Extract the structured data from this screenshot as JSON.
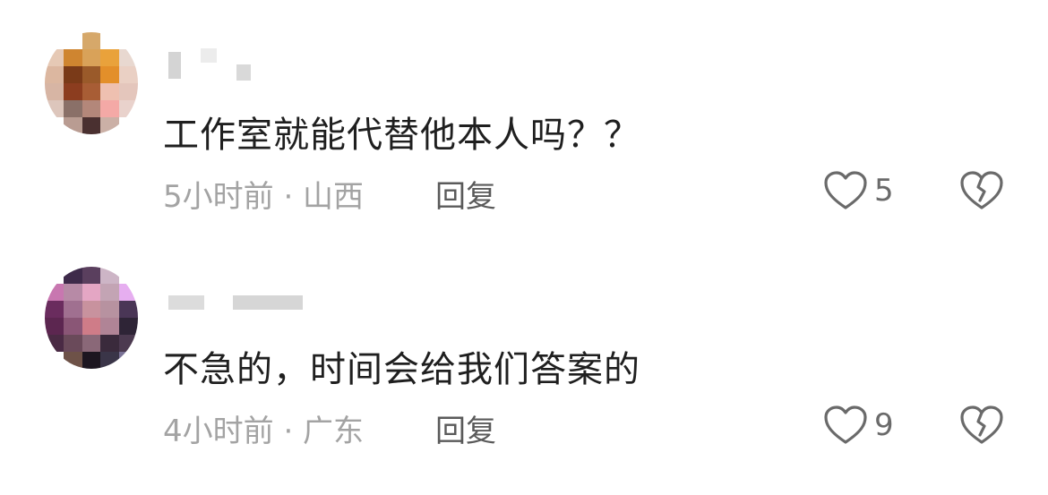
{
  "comments": [
    {
      "text": "工作室就能代替他本人吗？？",
      "meta": "5小时前 · 山西",
      "reply_label": "回复",
      "like_count": "5",
      "icons": {
        "like": "heart-outline-icon",
        "dislike": "broken-heart-icon"
      },
      "avatar_palette": [
        "#ffffff",
        "#ffffff",
        "#d6a86a",
        "#ffffff",
        "#ffffff",
        "#e6c9b5",
        "#cf8530",
        "#d9a259",
        "#e9a23b",
        "#e8d8d0",
        "#dcb7a0",
        "#7a3a18",
        "#9a5a2a",
        "#e38f2a",
        "#ead0c4",
        "#d7b5a4",
        "#8c3d1f",
        "#a85d35",
        "#eec0b0",
        "#e4c6bc",
        "#ddc6bc",
        "#8a7068",
        "#b3877a",
        "#f4a9a6",
        "#e9d2cc",
        "#ffffff",
        "#b99c92",
        "#4a3030",
        "#cbb0a6",
        "#ffffff"
      ]
    },
    {
      "text": "不急的，时间会给我们答案的",
      "meta": "4小时前 · 广东",
      "reply_label": "回复",
      "like_count": "9",
      "icons": {
        "like": "heart-outline-icon",
        "dislike": "broken-heart-icon"
      },
      "avatar_palette": [
        "#ffffff",
        "#3e2a4a",
        "#5a3f5e",
        "#cdb5c6",
        "#ffffff",
        "#c877b0",
        "#b78aa6",
        "#e4a6c4",
        "#c3a4b4",
        "#e6aef0",
        "#6a2c5e",
        "#a07090",
        "#c8929e",
        "#b792a0",
        "#4a3656",
        "#5c2650",
        "#8a5676",
        "#cf7c88",
        "#b08496",
        "#2e2436",
        "#4a2a44",
        "#6a4a5a",
        "#8a6878",
        "#3a2a3c",
        "#4c3a50",
        "#ffffff",
        "#6e5248",
        "#1c1620",
        "#3a3548",
        "#7a7296"
      ]
    }
  ]
}
